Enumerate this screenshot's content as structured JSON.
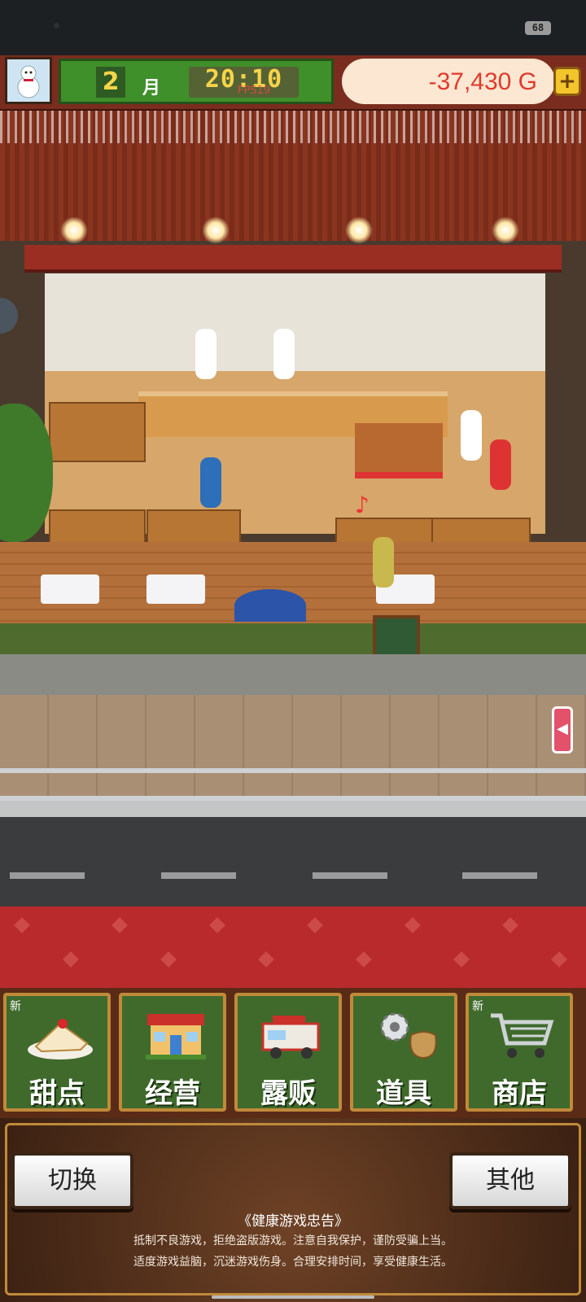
{
  "status_bar": {
    "battery": "68"
  },
  "hud": {
    "month_number": "2",
    "month_unit": "月",
    "time": "20:10",
    "fps": "FPS19",
    "money": "-37,430 G",
    "plus_symbol": "+"
  },
  "scene": {
    "side_tab_symbol": "◀"
  },
  "menu": {
    "new_badge": "新",
    "items": [
      {
        "label": "甜点",
        "icon": "cake-icon",
        "color": "#f6e9d8"
      },
      {
        "label": "经营",
        "icon": "shop-icon",
        "color": "#e9b45a"
      },
      {
        "label": "露贩",
        "icon": "food-truck-icon",
        "color": "#d9d3c8"
      },
      {
        "label": "道具",
        "icon": "gear-bag-icon",
        "color": "#c99a55"
      },
      {
        "label": "商店",
        "icon": "cart-icon",
        "color": "#cfd3d6"
      }
    ]
  },
  "bottom": {
    "switch_label": "切换",
    "other_label": "其他",
    "notice_title": "《健康游戏忠告》",
    "notice_line1": "抵制不良游戏，拒绝盗版游戏。注意自我保护，谨防受骗上当。",
    "notice_line2": "适度游戏益脑，沉迷游戏伤身。合理安排时间，享受健康生活。"
  },
  "colors": {
    "accent_red": "#b82a2c",
    "menu_green": "#3f6a2c",
    "money_red": "#e03a2c"
  }
}
